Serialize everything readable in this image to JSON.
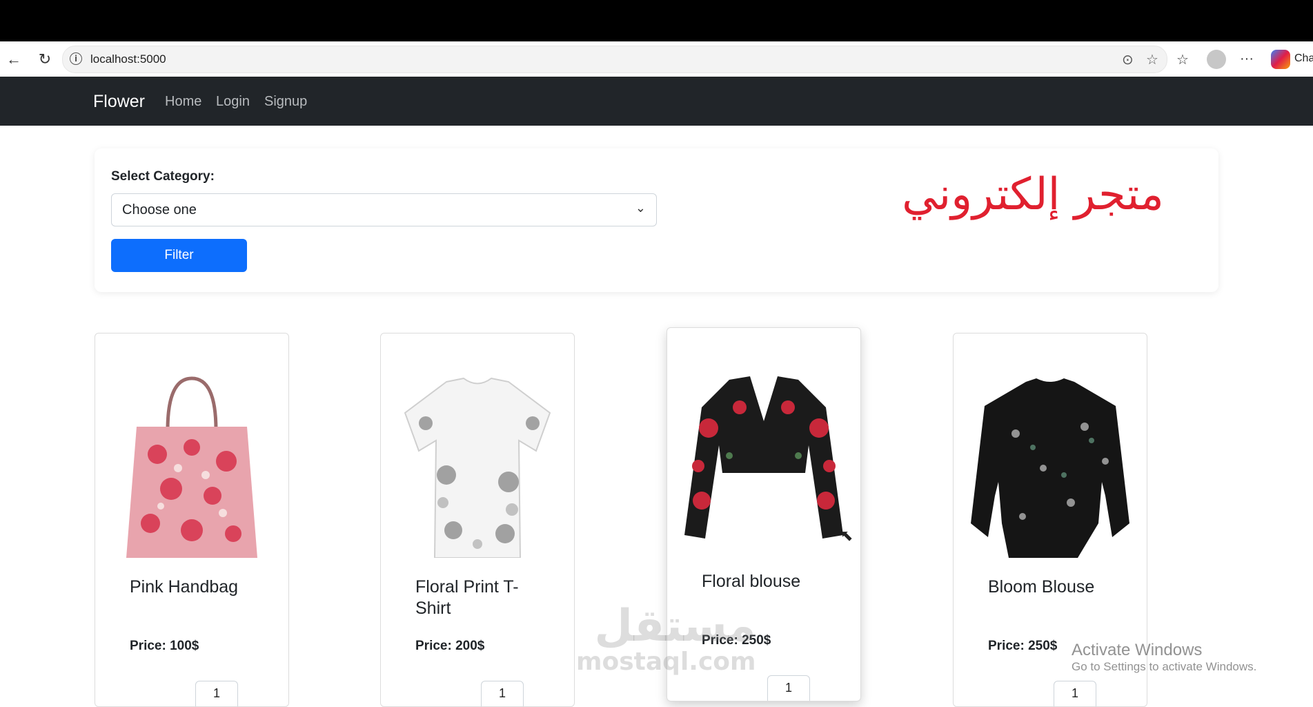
{
  "browser": {
    "url": "localhost:5000",
    "profile_label": "Cha"
  },
  "navbar": {
    "brand": "Flower",
    "links": [
      "Home",
      "Login",
      "Signup"
    ]
  },
  "filter": {
    "label": "Select Category:",
    "selected": "Choose one",
    "button": "Filter"
  },
  "banner_text": "متجر إلكتروني",
  "products": [
    {
      "title": "Pink Handbag",
      "price": "Price: 100$",
      "qty": "1"
    },
    {
      "title": "Floral Print T-Shirt",
      "price": "Price: 200$",
      "qty": "1"
    },
    {
      "title": "Floral blouse",
      "price": "Price: 250$",
      "qty": "1"
    },
    {
      "title": "Bloom Blouse",
      "price": "Price: 250$",
      "qty": "1"
    }
  ],
  "watermark": {
    "arabic": "مستقل",
    "latin": "mostaql.com"
  },
  "activation": {
    "title": "Activate Windows",
    "subtitle": "Go to Settings to activate Windows."
  }
}
